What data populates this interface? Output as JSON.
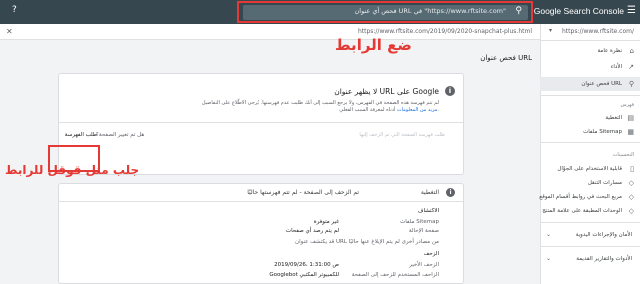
{
  "app": {
    "brand": "Google Search Console",
    "search_placeholder": "فحص أي عنوان URL في \"https://www.rftsite.com\""
  },
  "annotations": {
    "search_note": "ضع الرابط",
    "tab_note": "جلب مثل قوقل للرابط"
  },
  "sidebar": {
    "property": "https://www.rftsite.com/",
    "items": [
      {
        "label": "نظرة عامة",
        "icon": "home-icon"
      },
      {
        "label": "الأداء",
        "icon": "trending-icon"
      },
      {
        "label": "فحص عنوان URL",
        "icon": "search-icon",
        "active": true
      }
    ],
    "section_index": "فهرس",
    "index_items": [
      {
        "label": "التغطية",
        "icon": "coverage-icon"
      },
      {
        "label": "ملفات Sitemap",
        "icon": "sitemap-icon"
      }
    ],
    "section_enhancements": "التحسينات",
    "enh_items": [
      {
        "label": "قابلية الاستخدام على الجوّال",
        "icon": "mobile-icon"
      },
      {
        "label": "مسارات التنقل",
        "icon": "breadcrumb-icon"
      },
      {
        "label": "مربع البحث في روابط أقسام الموقع",
        "icon": "searchbox-icon"
      },
      {
        "label": "الوحدات المطبقة على علامة المنتج",
        "icon": "product-icon"
      }
    ],
    "groups": [
      {
        "label": "الأمان والإجراءات اليدوية"
      },
      {
        "label": "الأدوات والتقارير القديمة"
      }
    ]
  },
  "url_bar": {
    "url": "https://www.rftsite.com/2019/09/2020-snapchat-plus.html"
  },
  "page_title": "فحص عنوان URL",
  "status_card": {
    "headline": "لا يظهر عنوان URL على Google",
    "desc1": "لم تتم فهرسة هذه الصفحة في الفهرس، ولا يرجع السبب إلى أنك طلبت عدم فهرستها. يُرجى الاطّلاع على التفاصيل",
    "desc2_pre": "أدناه لمعرفة السبب الفعلي.",
    "desc2_link": "مزيد من المعلومات",
    "action_disabled": "طلب فهرسة الصفحة التي تم الزحف إليها",
    "tab_live_test": "هل تم تغيير الصفحة؟",
    "tab_fetched": "طلب الفهرسة"
  },
  "coverage_card": {
    "header_label": "التغطية",
    "header_value": "تم الزحف إلى الصفحة - لم تتم فهرستها حاليًا",
    "section_discovery": "الاكتشاف",
    "rows1": [
      {
        "label": "ملفات Sitemap",
        "value": "غير متوفرة"
      },
      {
        "label": "صفحة الإحالة",
        "value": "لم يتم رصد أي صفحات"
      }
    ],
    "note": "قد يكتشف عنوان URL من مصادر أخرى لم يتم الإبلاغ عنها حاليًا",
    "section_crawl": "الزحف",
    "rows2": [
      {
        "label": "الزحف الأخير",
        "value": "2019/09/26، 1:31:00 ص"
      },
      {
        "label": "الزاحف المستخدم للزحف إلى الصفحة",
        "value": "Googlebot للكمبيوتر المكتبي"
      }
    ]
  }
}
